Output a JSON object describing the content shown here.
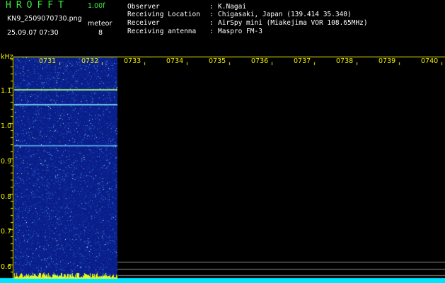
{
  "header": {
    "logo": "HROFFT",
    "version": "1.00f",
    "filename": "KN9_2509070730.png",
    "datetime": "25.09.07 07:30",
    "counter_label": "meteor",
    "counter_value": "8",
    "info": [
      {
        "label": "Observer",
        "value": "K.Nagai"
      },
      {
        "label": "Receiving Location",
        "value": "Chigasaki, Japan (139.414 35.340)"
      },
      {
        "label": "Receiver",
        "value": "AirSpy mini (Miakejima VOR 108.65MHz)"
      },
      {
        "label": "Receiving antenna",
        "value": "Maspro FM-3"
      }
    ],
    "colon": ":"
  },
  "axis": {
    "y_unit_label": "kHz",
    "y_ticks": [
      "1.1",
      "1.0",
      "0.9",
      "0.8",
      "0.7",
      "0.6"
    ],
    "x_ticks": [
      "0731",
      "0732",
      "0733",
      "0734",
      "0735",
      "0736",
      "0737",
      "0738",
      "0739",
      "0740"
    ]
  },
  "colors": {
    "axis": "#f2f200",
    "text": "#ffffff",
    "logo": "#3cf03c",
    "band": "#00e5ff",
    "noise": "#0a1f8c"
  }
}
